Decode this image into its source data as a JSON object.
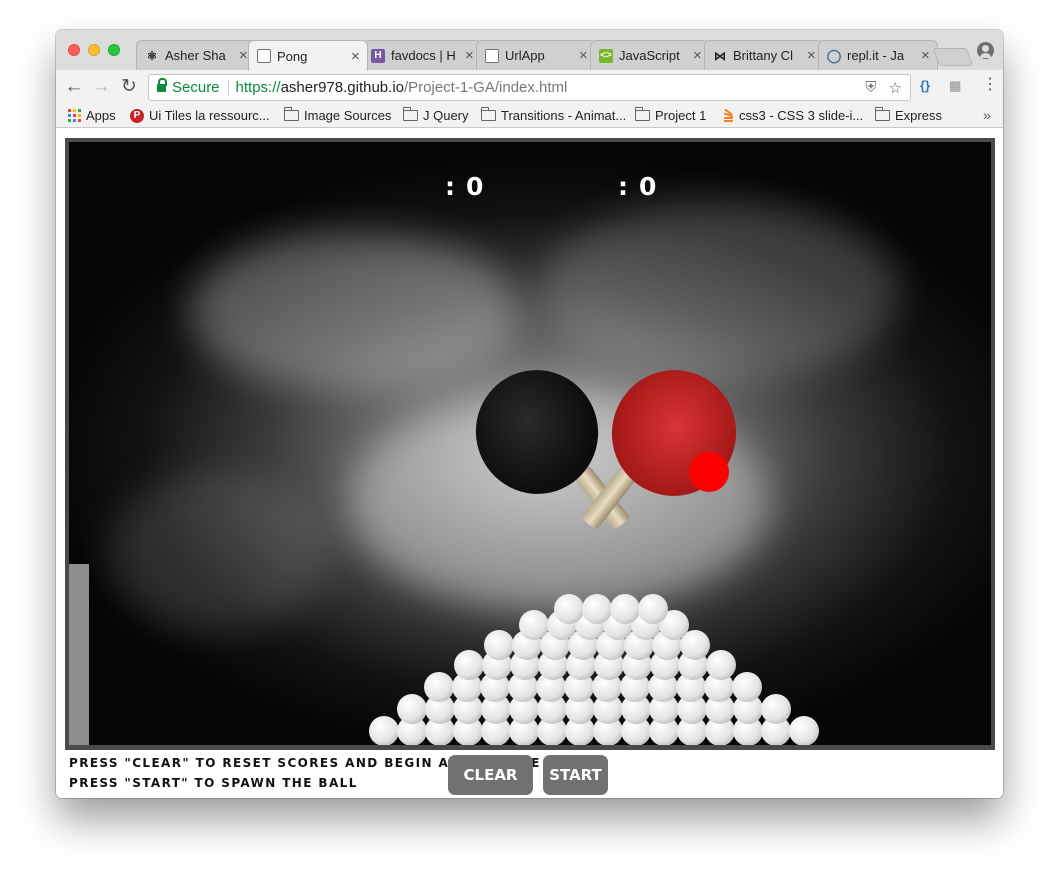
{
  "tabs": [
    {
      "label": "Asher Sha",
      "icon": "github-icon",
      "active": false
    },
    {
      "label": "Pong",
      "icon": "page-icon",
      "active": true
    },
    {
      "label": "favdocs | H",
      "icon": "heroku-icon",
      "active": false
    },
    {
      "label": "UrlApp",
      "icon": "page-icon",
      "active": false
    },
    {
      "label": "JavaScript",
      "icon": "codepen-icon",
      "active": false
    },
    {
      "label": "Brittany Cl",
      "icon": "bowtie-icon",
      "active": false
    },
    {
      "label": "repl.it - Ja",
      "icon": "replit-icon",
      "active": false
    }
  ],
  "toolbar": {
    "secure_label": "Secure",
    "url_scheme": "https://",
    "url_host": "asher978.github.io",
    "url_path": "/Project-1-GA/index.html"
  },
  "bookmarks": [
    {
      "label": "Apps",
      "icon": "apps-icon"
    },
    {
      "label": "Ui Tiles la ressourc...",
      "icon": "pinterest-icon"
    },
    {
      "label": "Image Sources",
      "icon": "folder-icon"
    },
    {
      "label": "J Query",
      "icon": "folder-icon"
    },
    {
      "label": "Transitions - Animat...",
      "icon": "folder-icon"
    },
    {
      "label": "Project 1",
      "icon": "folder-icon"
    },
    {
      "label": "css3 - CSS 3 slide-i...",
      "icon": "stackoverflow-icon"
    },
    {
      "label": "Express",
      "icon": "folder-icon"
    }
  ],
  "game": {
    "player1_score": "0",
    "player2_score": "0",
    "score_separator": ":",
    "ball_color": "#ff0000",
    "paddle_color": "#8e8e8e"
  },
  "instructions": {
    "line1": "PRESS \"CLEAR\" TO RESET SCORES AND BEGIN A NEW GAME",
    "line2": "PRESS \"START\" TO SPAWN THE BALL"
  },
  "buttons": {
    "clear": "CLEAR",
    "start": "START"
  }
}
